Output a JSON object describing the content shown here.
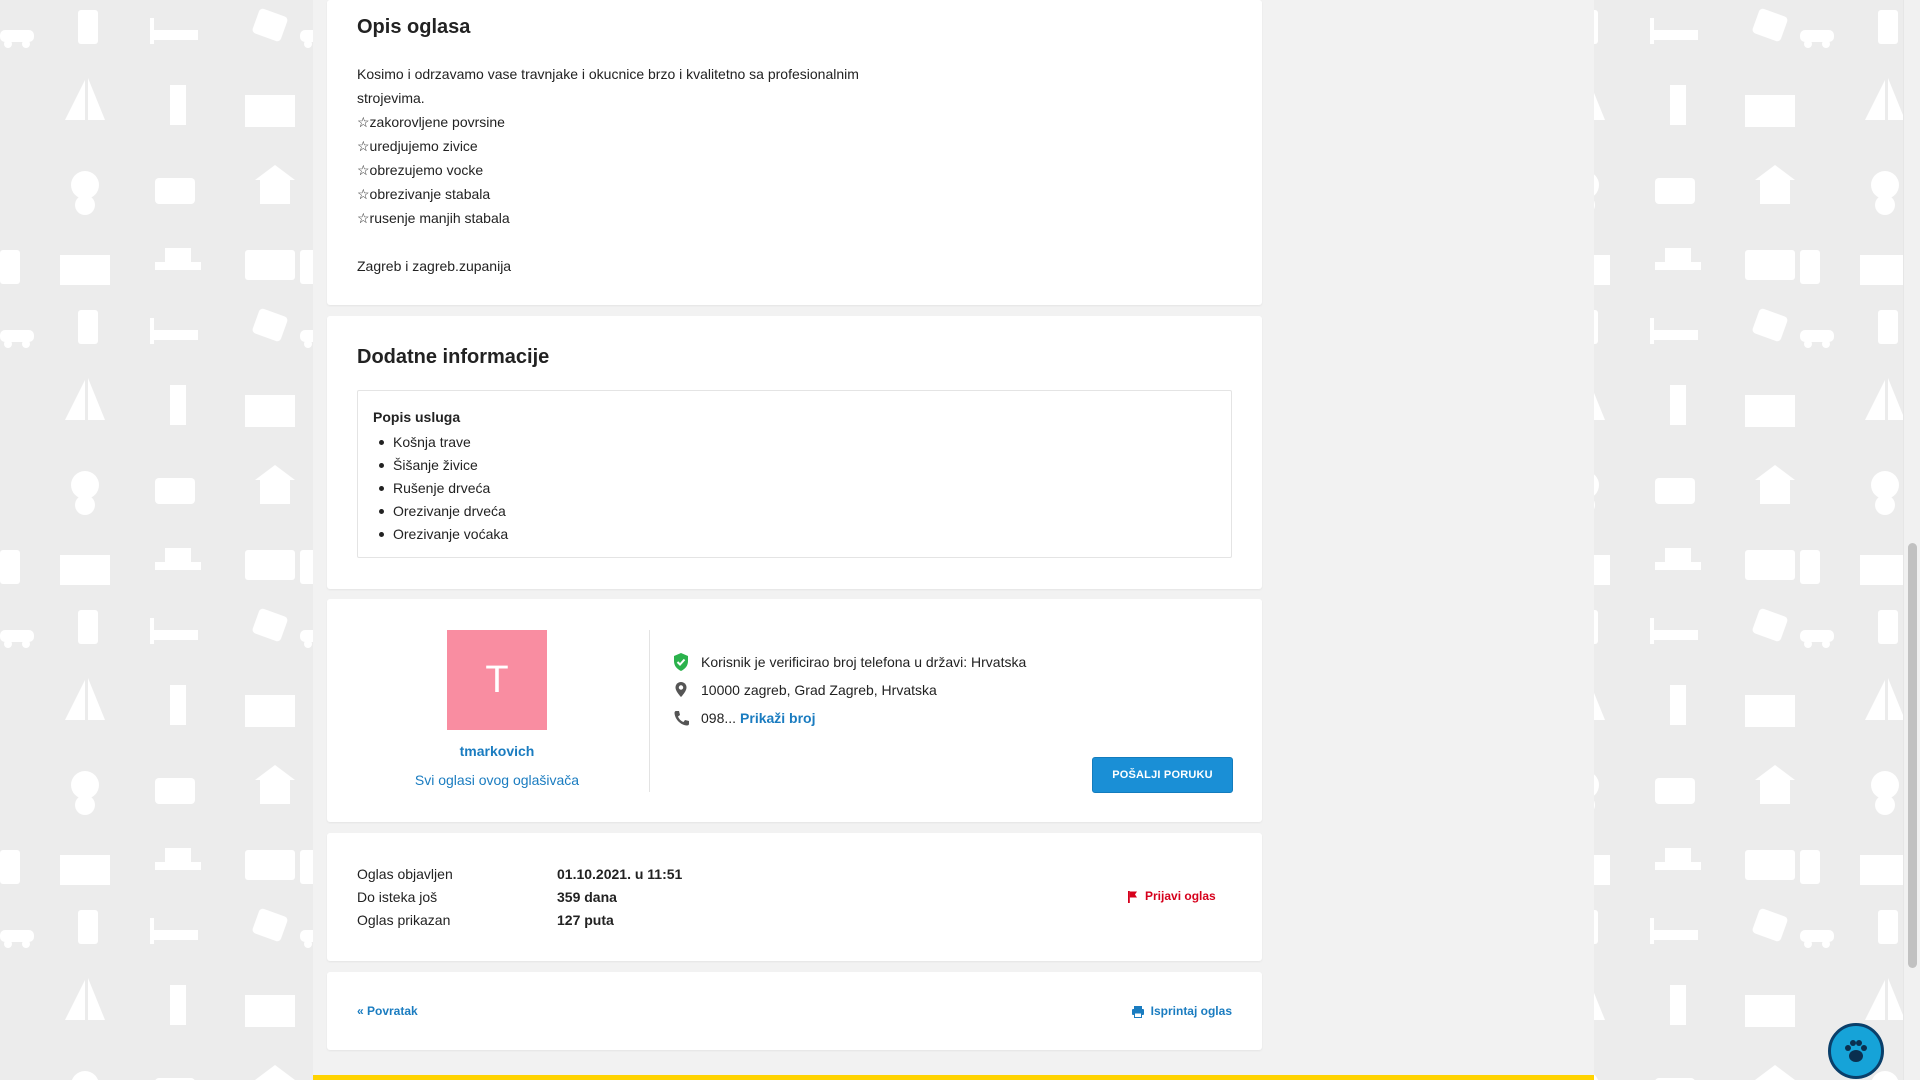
{
  "description": {
    "title": "Opis oglasa",
    "lines": [
      "Kosimo i odrzavamo vase travnjake i okucnice brzo i kvalitetno sa profesionalnim",
      "strojevima.",
      "☆zakorovljene povrsine",
      "☆uredjujemo zivice",
      "☆obrezujemo vocke",
      "☆obrezivanje stabala",
      "☆rusenje manjih stabala",
      "",
      "Zagreb i zagreb.zupanija"
    ]
  },
  "extra": {
    "title": "Dodatne informacije",
    "services_title": "Popis usluga",
    "services": [
      "Košnja trave",
      "Šišanje živice",
      "Rušenje drveća",
      "Orezivanje drveća",
      "Orezivanje voćaka"
    ]
  },
  "seller": {
    "avatar_letter": "T",
    "avatar_color": "#f98da1",
    "name": "tmarkovich",
    "all_ads": "Svi oglasi ovog oglašivača",
    "verified_text": "Korisnik je verificirao broj telefona u državi: Hrvatska",
    "location": "10000 zagreb, Grad Zagreb, Hrvatska",
    "phone_prefix": "098...",
    "show_number": "Prikaži broj",
    "message_button": "POŠALJI PORUKU"
  },
  "meta": {
    "published_label": "Oglas objavljen",
    "published_value": "01.10.2021. u 11:51",
    "expires_label": "Do isteka još",
    "expires_value": "359 dana",
    "views_label": "Oglas prikazan",
    "views_value": "127 puta",
    "report": "Prijavi oglas"
  },
  "nav": {
    "back": "« Povratak",
    "print": "Isprintaj oglas"
  },
  "colors": {
    "accent": "#1a7cc0",
    "button": "#1a8fd6",
    "report": "#d6001c",
    "verified": "#2bb24c",
    "footer_bar": "#ffd300"
  }
}
